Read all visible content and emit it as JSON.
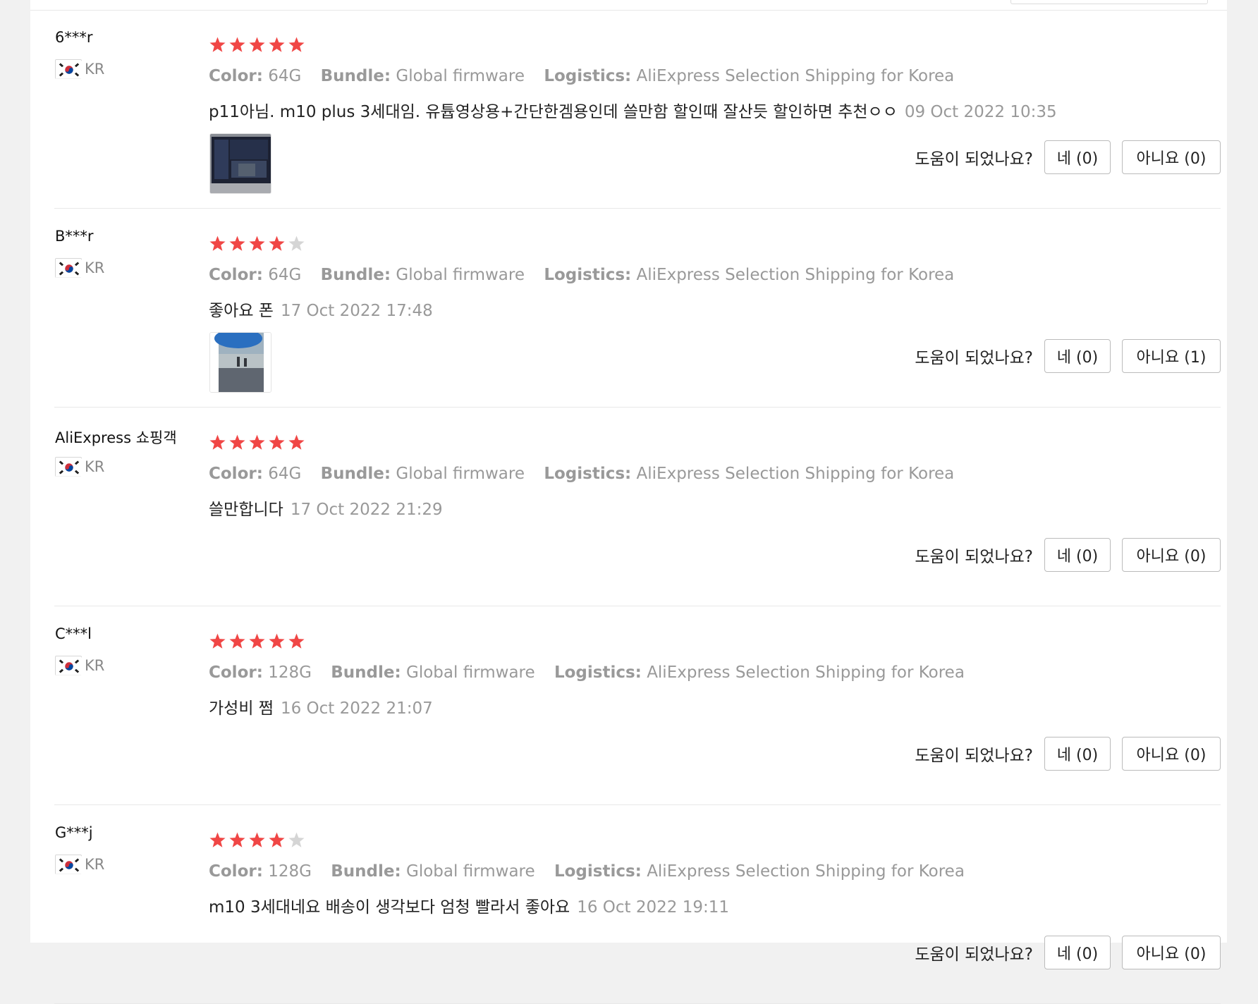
{
  "helpful_question": "도움이 되었나요?",
  "labels": {
    "color": "Color:",
    "bundle": "Bundle:",
    "logistics": "Logistics:"
  },
  "star_colors": {
    "filled": "#f04645",
    "empty": "#d5d5d5"
  },
  "reviews": [
    {
      "user": "6***r",
      "country": "KR",
      "rating": 5,
      "color": "64G",
      "bundle": "Global firmware",
      "logistics": "AliExpress Selection Shipping for Korea",
      "text": "p11아님. m10 plus 3세대임. 유튭영상용+간단한겜용인데 쓸만함 할인때 잘산듯 할인하면 추천ㅇㅇ",
      "date": "09 Oct 2022 10:35",
      "photo": "tablet-photo",
      "yes": "네 (0)",
      "no": "아니요 (0)"
    },
    {
      "user": "B***r",
      "country": "KR",
      "rating": 4,
      "color": "64G",
      "bundle": "Global firmware",
      "logistics": "AliExpress Selection Shipping for Korea",
      "text": "좋아요 폰",
      "date": "17 Oct 2022 17:48",
      "photo": "outdoor-photo",
      "yes": "네 (0)",
      "no": "아니요 (1)"
    },
    {
      "user": "AliExpress 쇼핑객",
      "country": "KR",
      "rating": 5,
      "color": "64G",
      "bundle": "Global firmware",
      "logistics": "AliExpress Selection Shipping for Korea",
      "text": "쓸만합니다",
      "date": "17 Oct 2022 21:29",
      "yes": "네 (0)",
      "no": "아니요 (0)"
    },
    {
      "user": "C***l",
      "country": "KR",
      "rating": 5,
      "color": "128G",
      "bundle": "Global firmware",
      "logistics": "AliExpress Selection Shipping for Korea",
      "text": "가성비 쩜",
      "date": "16 Oct 2022 21:07",
      "yes": "네 (0)",
      "no": "아니요 (0)"
    },
    {
      "user": "G***j",
      "country": "KR",
      "rating": 4,
      "color": "128G",
      "bundle": "Global firmware",
      "logistics": "AliExpress Selection Shipping for Korea",
      "text": "m10 3세대네요 배송이 생각보다 엄청 빨라서 좋아요",
      "date": "16 Oct 2022 19:11",
      "yes": "네 (0)",
      "no": "아니요 (0)"
    }
  ]
}
